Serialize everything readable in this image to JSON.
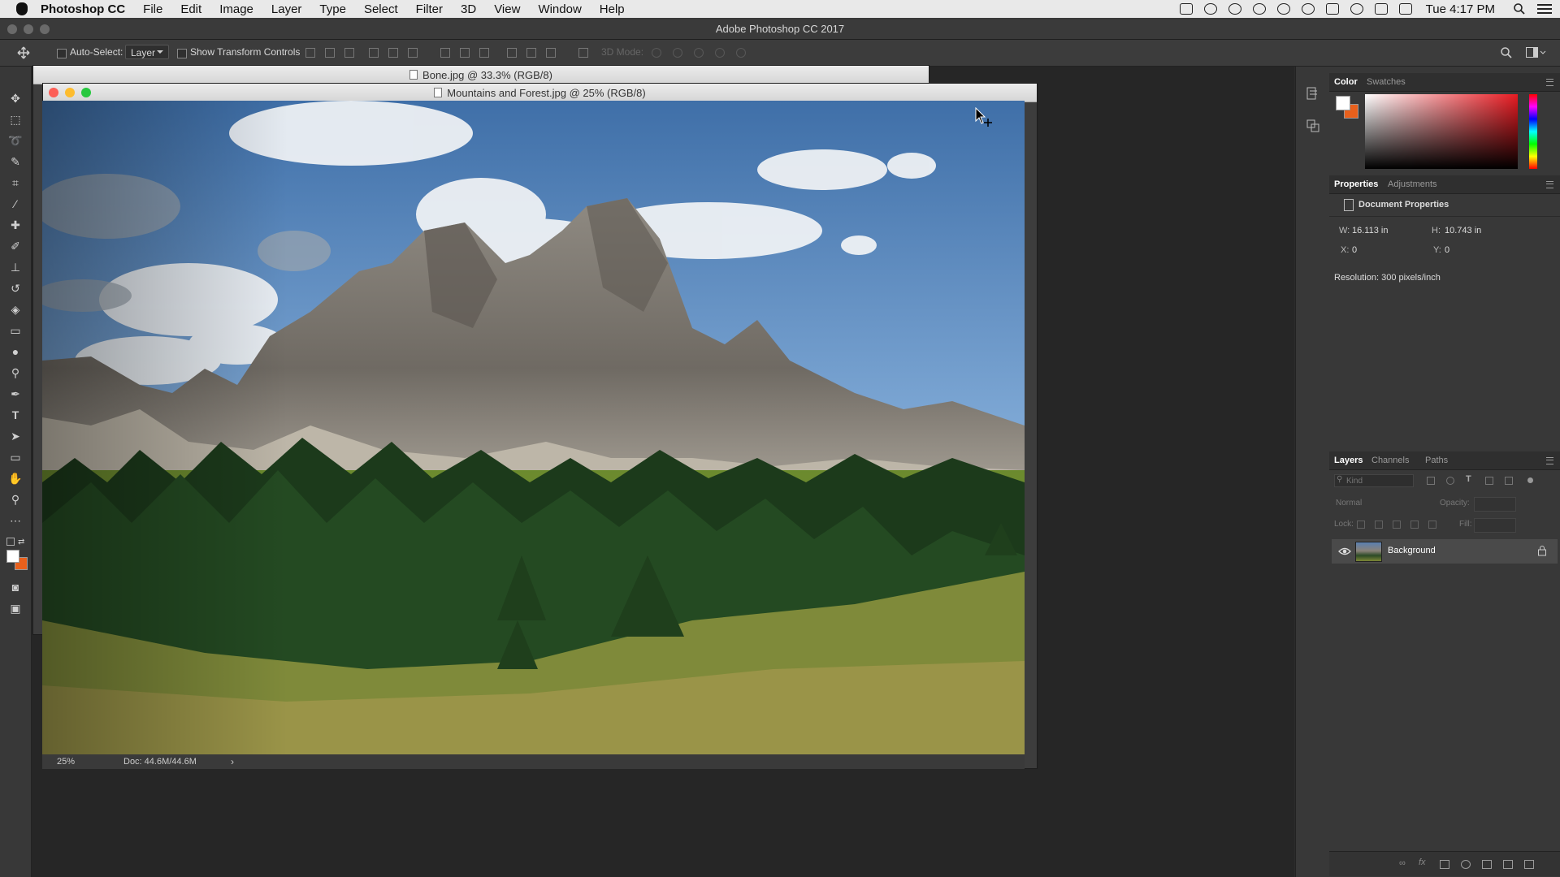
{
  "menubar": {
    "app_name": "Photoshop CC",
    "menus": [
      "File",
      "Edit",
      "Image",
      "Layer",
      "Type",
      "Select",
      "Filter",
      "3D",
      "View",
      "Window",
      "Help"
    ],
    "clock": "Tue 4:17 PM",
    "status_icons": [
      "screen-record-icon",
      "creative-cloud-icon",
      "cloud-icon",
      "sync-icon",
      "backup-icon",
      "drive-icon",
      "airplay-icon",
      "wifi-icon",
      "eject-icon",
      "volume-icon"
    ]
  },
  "app_title": "Adobe Photoshop CC 2017",
  "options_bar": {
    "auto_select_label": "Auto-Select:",
    "auto_select_target": "Layer",
    "show_transform_label": "Show Transform Controls",
    "mode_3d_label": "3D Mode:"
  },
  "tools": [
    "move-tool-icon",
    "marquee-tool-icon",
    "lasso-tool-icon",
    "quick-select-tool-icon",
    "crop-tool-icon",
    "eyedropper-tool-icon",
    "healing-brush-tool-icon",
    "brush-tool-icon",
    "clone-stamp-tool-icon",
    "history-brush-tool-icon",
    "eraser-tool-icon",
    "gradient-tool-icon",
    "blur-tool-icon",
    "dodge-tool-icon",
    "pen-tool-icon",
    "type-tool-icon",
    "path-select-tool-icon",
    "rectangle-tool-icon",
    "hand-tool-icon",
    "zoom-tool-icon",
    "more-tools-icon"
  ],
  "colors": {
    "foreground": "#ffffff",
    "background": "#e8601c"
  },
  "documents": {
    "back_doc_title": "Bone.jpg @ 33.3% (RGB/8)",
    "front_doc_title": "Mountains and Forest.jpg @ 25% (RGB/8)",
    "zoom": "25%",
    "doc_size": "Doc: 44.6M/44.6M"
  },
  "color_panel": {
    "tabs": [
      "Color",
      "Swatches"
    ],
    "active_tab": "Color"
  },
  "properties_panel": {
    "tabs": [
      "Properties",
      "Adjustments"
    ],
    "active_tab": "Properties",
    "header": "Document Properties",
    "w_label": "W:",
    "w_value": "16.113 in",
    "h_label": "H:",
    "h_value": "10.743 in",
    "x_label": "X:",
    "x_value": "0",
    "y_label": "Y:",
    "y_value": "0",
    "resolution": "Resolution: 300 pixels/inch"
  },
  "layers_panel": {
    "tabs": [
      "Layers",
      "Channels",
      "Paths"
    ],
    "active_tab": "Layers",
    "filter_placeholder": "Kind",
    "blend_mode": "Normal",
    "opacity_label": "Opacity:",
    "lock_label": "Lock:",
    "fill_label": "Fill:",
    "layers": [
      {
        "name": "Background",
        "locked": true,
        "visible": true
      }
    ]
  }
}
